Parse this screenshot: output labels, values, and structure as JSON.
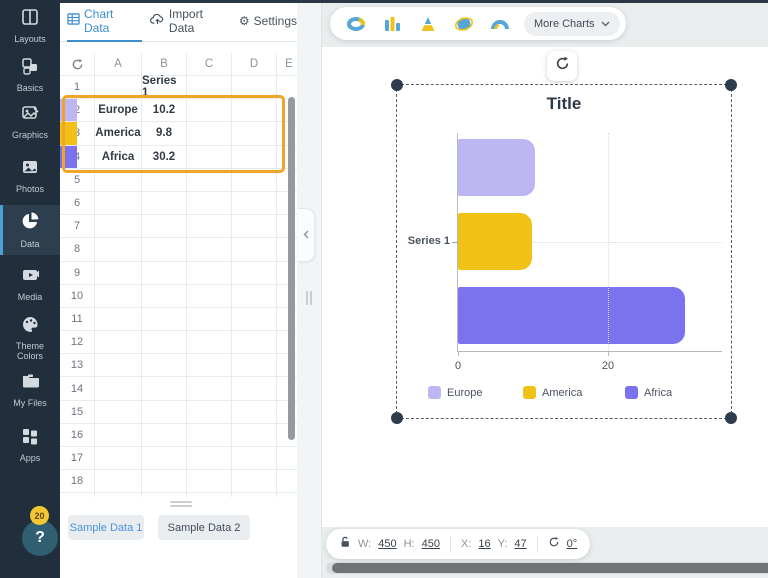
{
  "sidebar": {
    "items": [
      {
        "label": "Layouts",
        "icon": "layouts-icon"
      },
      {
        "label": "Basics",
        "icon": "basics-icon"
      },
      {
        "label": "Graphics",
        "icon": "graphics-icon"
      },
      {
        "label": "Photos",
        "icon": "photos-icon"
      },
      {
        "label": "Data",
        "icon": "data-icon",
        "active": true
      },
      {
        "label": "Media",
        "icon": "media-icon"
      },
      {
        "label": "Theme Colors",
        "icon": "theme-colors-icon"
      },
      {
        "label": "My Files",
        "icon": "my-files-icon"
      },
      {
        "label": "Apps",
        "icon": "apps-icon"
      }
    ],
    "help_label": "?",
    "help_badge": "20"
  },
  "panel": {
    "tabs": [
      {
        "label": "Chart Data",
        "icon": "table-icon",
        "active": true
      },
      {
        "label": "Import Data",
        "icon": "cloud-upload-icon",
        "active": false
      },
      {
        "label": "Settings",
        "icon": "gear-icon",
        "icon_glyph": "⚙",
        "active": false
      }
    ],
    "spreadsheet": {
      "columns": [
        "A",
        "B",
        "C",
        "D",
        "E"
      ],
      "visible_row_count": 19,
      "rows": [
        {
          "num": "1",
          "a": "",
          "b": "Series 1",
          "swatch": ""
        },
        {
          "num": "2",
          "a": "Europe",
          "b": "10.2",
          "swatch": "#bcb6f3"
        },
        {
          "num": "3",
          "a": "America",
          "b": "9.8",
          "swatch": "#f2c117"
        },
        {
          "num": "4",
          "a": "Africa",
          "b": "30.2",
          "swatch": "#7b72ee"
        }
      ],
      "highlight_color": "#f0a529"
    },
    "sample_buttons": [
      {
        "label": "Sample Data 1"
      },
      {
        "label": "Sample Data 2"
      }
    ]
  },
  "chart_toolbar": {
    "icons": [
      "donut-chart-icon",
      "bar-chart-icon",
      "pyramid-chart-icon",
      "sphere-chart-icon",
      "arc-chart-icon"
    ],
    "more_charts_label": "More Charts"
  },
  "chart_data": {
    "type": "bar",
    "orientation": "horizontal",
    "title": "Title",
    "series_label": "Series 1",
    "categories": [
      "Europe",
      "America",
      "Africa"
    ],
    "values": [
      10.2,
      9.8,
      30.2
    ],
    "colors": [
      "#bcb6f3",
      "#f2c117",
      "#7b72ee"
    ],
    "x_ticks": [
      0,
      20
    ],
    "xlim": [
      0,
      35.3
    ],
    "grid": true,
    "legend_position": "bottom"
  },
  "position_toolbar": {
    "w_label": "W:",
    "w_value": "450",
    "h_label": "H:",
    "h_value": "450",
    "x_label": "X:",
    "x_value": "16",
    "y_label": "Y:",
    "y_value": "47",
    "rotation_value": "0°"
  },
  "accent_colors": {
    "active_blue": "#3e8fcc",
    "sidebar_bg": "#212e3b",
    "highlight_orange": "#f0a529"
  }
}
